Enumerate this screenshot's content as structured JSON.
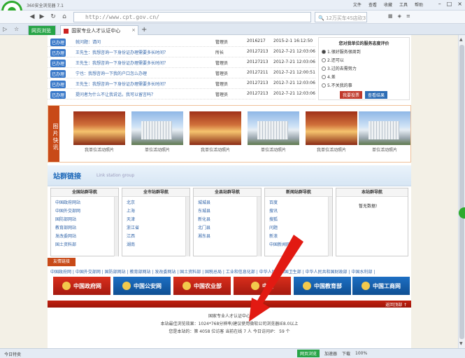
{
  "browser": {
    "app_name": "360安全浏览器 7.1",
    "menu": [
      "文件",
      "查看",
      "收藏",
      "工具",
      "帮助"
    ],
    "url": "http://www.cpt.gov.cn/",
    "search_placeholder": "12万买车4S店砍37万",
    "tabs": [
      {
        "label": "网页浏览"
      },
      {
        "label": "国家专业人才认证中心"
      }
    ],
    "new_tab": "+",
    "status_left": "今日特卖",
    "status_items": [
      "网页浏览",
      "加速器",
      "下载",
      "100%"
    ]
  },
  "messages": [
    {
      "status": "已办理",
      "text": "就问题：请问",
      "role": "管理员",
      "num": "2016217",
      "date": "2015-2-1 16:12:50"
    },
    {
      "status": "已办理",
      "text": "王先生：我想咨询一下身份证办理需要多长时间？",
      "role": "所长",
      "num": "20127213",
      "date": "2012-7-21 12:03:06"
    },
    {
      "status": "已办理",
      "text": "王先生：我想咨询一下身份证办理需要多长时间？",
      "role": "管理员",
      "num": "20127213",
      "date": "2012-7-21 12:03:06"
    },
    {
      "status": "已办理",
      "text": "宁也：我想咨询一下我的户口怎么办理",
      "role": "管理员",
      "num": "20127211",
      "date": "2012-7-21 12:00:51"
    },
    {
      "status": "已办理",
      "text": "王先生：我想咨询一下身份证办理需要多长时间？",
      "role": "管理员",
      "num": "20127213",
      "date": "2012-7-21 12:03:06"
    },
    {
      "status": "已办理",
      "text": "提问者为什么不让我说话，我可以留言吗？",
      "role": "管理员",
      "num": "20127213",
      "date": "2012-7-21 12:03:06"
    }
  ],
  "poll": {
    "title": "您对我单位的服务态度评价",
    "options": [
      "1.很好服务很周到",
      "2.还可以",
      "3.过的去需努力",
      "4.差",
      "5.不关我的事"
    ],
    "selected_index": 0,
    "vote_btn": "我要投票",
    "result_btn": "查看结果"
  },
  "photos": {
    "label": "图片快讯",
    "items": [
      {
        "caption": "我单位活动照片",
        "kind": "hall"
      },
      {
        "caption": "单位活动照片",
        "kind": "bldg"
      },
      {
        "caption": "我单位活动照片",
        "kind": "hall"
      },
      {
        "caption": "单位活动照片",
        "kind": "bldg"
      },
      {
        "caption": "我单位活动照片",
        "kind": "hall"
      },
      {
        "caption": "单位活动照片",
        "kind": "bldg"
      }
    ]
  },
  "sites": {
    "title": "站群链接",
    "subtitle": "Link station group"
  },
  "nav_columns": [
    {
      "title": "全国站群导航",
      "items": [
        "中国政府网站",
        "中国外交部网",
        "国防部网站",
        "教育部网站",
        "发改委网站",
        "国土资料部"
      ]
    },
    {
      "title": "全市站群导航",
      "items": [
        "北京",
        "上海",
        "天津",
        "浙江省",
        "江西",
        "湖南"
      ]
    },
    {
      "title": "全县站群导航",
      "items": [
        "城城县",
        "东城县",
        "新化县",
        "北门县",
        "湘东县"
      ]
    },
    {
      "title": "新闻站群导航",
      "items": [
        "百度",
        "搜讯",
        "搜狐",
        "问题",
        "新浪",
        "中国新闻网"
      ]
    },
    {
      "title": "本站群导航",
      "items": [],
      "nodata": "暂无数据!"
    }
  ],
  "friend": {
    "title": "友情链接",
    "links": "中国政府网 | 中国外交部网 | 国防部网站 | 教育部网站 | 发改委网站 | 国土资料部 | 国税总局 | 工业和信息化部 | 中华人民共和国卫生部 | 中华人民共和国财政部 | 中国水利部 |",
    "banners": [
      {
        "label": "中国政府网",
        "color": "red"
      },
      {
        "label": "中国公安网",
        "color": "blue"
      },
      {
        "label": "中国农业部",
        "color": "red"
      },
      {
        "label": "中国",
        "color": "red"
      },
      {
        "label": "中国教育部",
        "color": "blue"
      },
      {
        "label": "中国工商网",
        "color": "blue"
      }
    ]
  },
  "redbar": {
    "back": "返回顶部 ↑"
  },
  "footer": {
    "line1": "国家专业人才认证中心",
    "line2": "本站最佳浏览效果：1024*768分辨率/建议使用微软公司浏览器IE8.0以上",
    "line3": "您是本站的：第 4058 位访客  当前在线 7 人 今日访问IP： 59 个"
  }
}
